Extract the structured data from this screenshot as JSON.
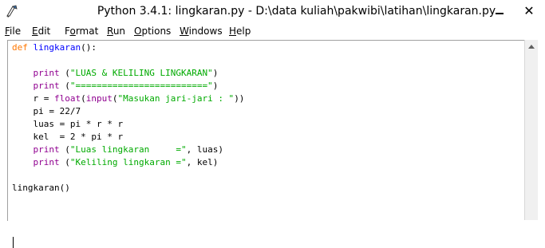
{
  "window": {
    "title": "Python 3.4.1: lingkaran.py - D:\\data kuliah\\pakwibi\\latihan\\lingkaran.py",
    "close_glyph": "✕"
  },
  "menu": [
    {
      "u": "F",
      "rest": "ile"
    },
    {
      "u": "E",
      "rest": "dit"
    },
    {
      "u": "",
      "rest": "Format",
      "u_at": 1
    },
    {
      "u": "R",
      "rest": "un"
    },
    {
      "u": "O",
      "rest": "ptions"
    },
    {
      "u": "W",
      "rest": "indows"
    },
    {
      "u": "H",
      "rest": "elp"
    }
  ],
  "editor": {
    "lines": [
      [
        {
          "t": "def",
          "c": "kw"
        },
        {
          "t": " "
        },
        {
          "t": "lingkaran",
          "c": "def"
        },
        {
          "t": "():"
        }
      ],
      [],
      [
        {
          "t": "    "
        },
        {
          "t": "print",
          "c": "bi"
        },
        {
          "t": " ("
        },
        {
          "t": "\"LUAS & KELILING LINGKARAN\"",
          "c": "str"
        },
        {
          "t": ")"
        }
      ],
      [
        {
          "t": "    "
        },
        {
          "t": "print",
          "c": "bi"
        },
        {
          "t": " ("
        },
        {
          "t": "\"=========================\"",
          "c": "str"
        },
        {
          "t": ")"
        }
      ],
      [
        {
          "t": "    r = "
        },
        {
          "t": "float",
          "c": "bi"
        },
        {
          "t": "("
        },
        {
          "t": "input",
          "c": "bi"
        },
        {
          "t": "("
        },
        {
          "t": "\"Masukan jari-jari : \"",
          "c": "str"
        },
        {
          "t": "))"
        }
      ],
      [
        {
          "t": "    pi = 22/7"
        }
      ],
      [
        {
          "t": "    luas = pi * r * r"
        }
      ],
      [
        {
          "t": "    kel  = 2 * pi * r"
        }
      ],
      [
        {
          "t": "    "
        },
        {
          "t": "print",
          "c": "bi"
        },
        {
          "t": " ("
        },
        {
          "t": "\"Luas lingkaran     =\"",
          "c": "str"
        },
        {
          "t": ", luas)"
        }
      ],
      [
        {
          "t": "    "
        },
        {
          "t": "print",
          "c": "bi"
        },
        {
          "t": " ("
        },
        {
          "t": "\"Keliling lingkaran =\"",
          "c": "str"
        },
        {
          "t": ", kel)"
        }
      ],
      [],
      [
        {
          "t": "lingkaran()"
        }
      ],
      []
    ]
  },
  "icons": {
    "app": "python-idle-icon",
    "minimize": "minimize-icon",
    "close": "close-icon",
    "scroll_up": "scroll-up-arrow-icon"
  }
}
